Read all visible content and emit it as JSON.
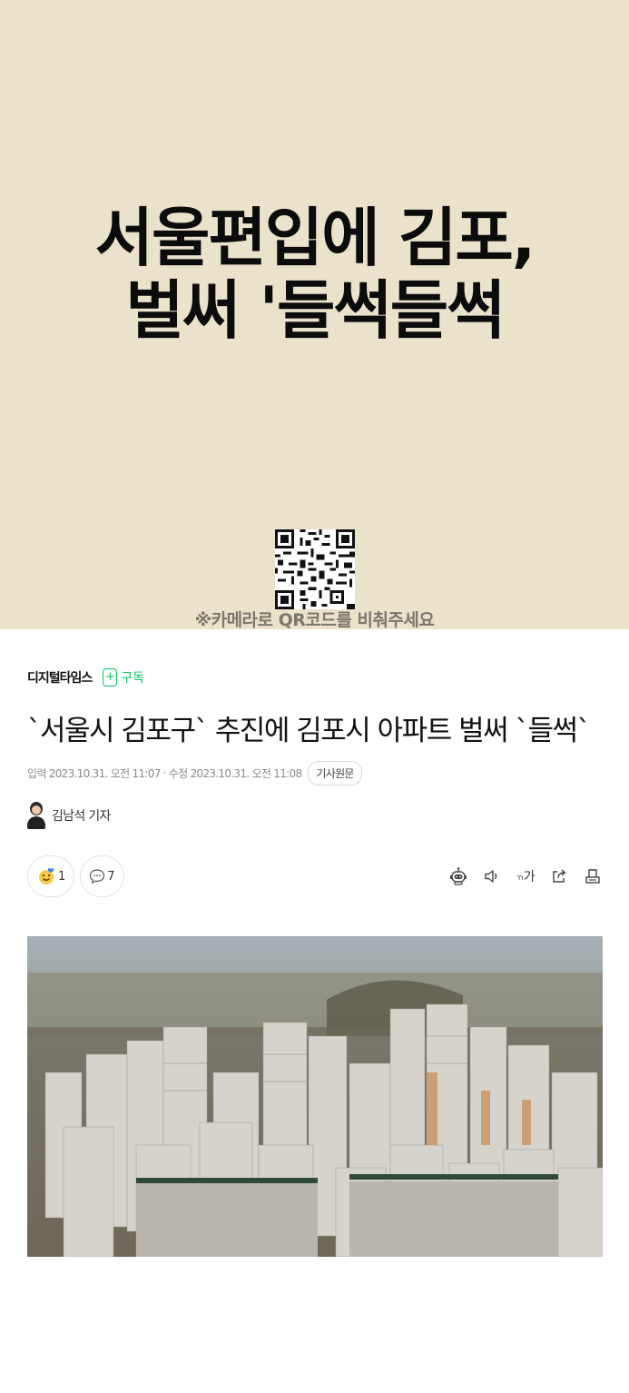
{
  "hero": {
    "title_line1": "서울편입에 김포,",
    "title_line2": "벌써 '들썩들썩",
    "qr_caption": "※카메라로 QR코드를 비춰주세요"
  },
  "article": {
    "publisher": "디지털타임스",
    "subscribe_label": "구독",
    "headline": "`서울시 김포구` 추진에 김포시 아파트 벌써 `들썩`",
    "meta": {
      "input_label": "입력",
      "input_time": "2023.10.31. 오전 11:07",
      "separator": "·",
      "edit_label": "수정",
      "edit_time": "2023.10.31. 오전 11:08",
      "original_button": "기사원문"
    },
    "reporter": "김남석 기자",
    "reactions": {
      "like_count": "1",
      "comment_count": "7"
    },
    "tools": {
      "font_size_label": "가"
    }
  },
  "colors": {
    "hero_bg": "#ebe2cb",
    "accent_green": "#03c75a"
  }
}
